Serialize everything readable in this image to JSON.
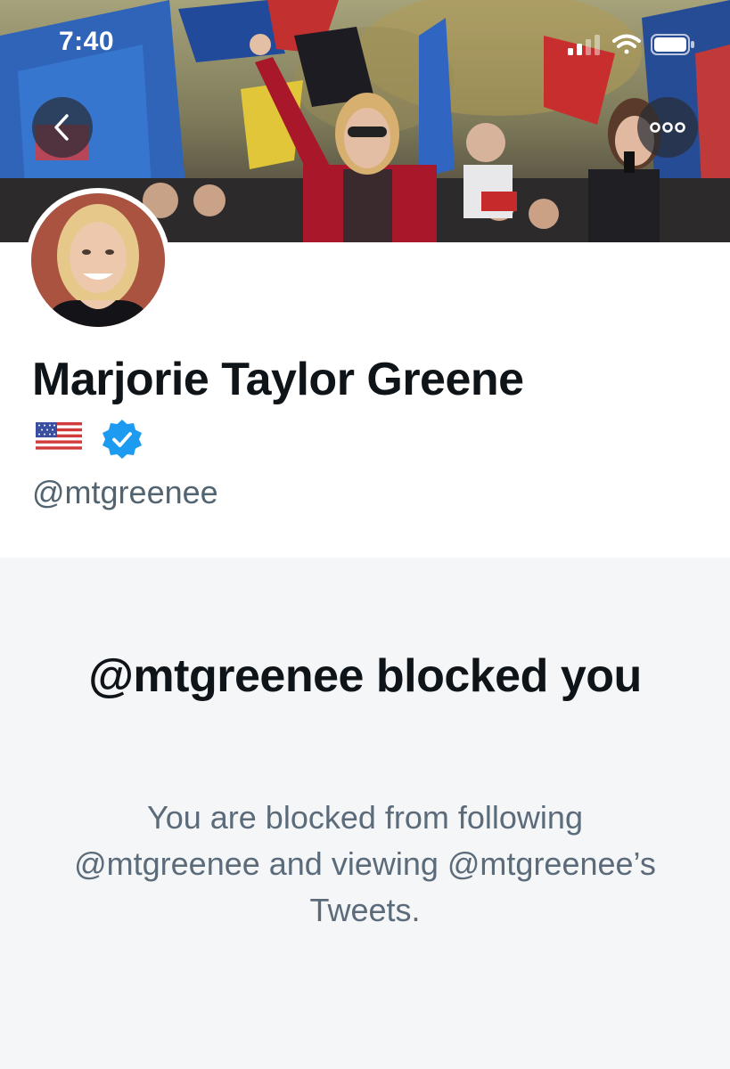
{
  "status_bar": {
    "time": "7:40"
  },
  "header": {
    "back_icon": "chevron-left-icon",
    "more_icon": "more-horizontal-icon"
  },
  "profile": {
    "name": "Marjorie Taylor Greene",
    "flag_emoji": "🇺🇸",
    "verified_icon": "verified-badge-icon",
    "handle": "@mtgreenee"
  },
  "blocked": {
    "title": "@mtgreenee blocked you",
    "description": "You are blocked from following @mtgreenee and viewing @mtgreenee’s Tweets."
  },
  "colors": {
    "name_text": "#0f1419",
    "handle_text": "#536471",
    "verified_blue": "#1d9bf0",
    "panel_bg": "#f5f6f8"
  }
}
